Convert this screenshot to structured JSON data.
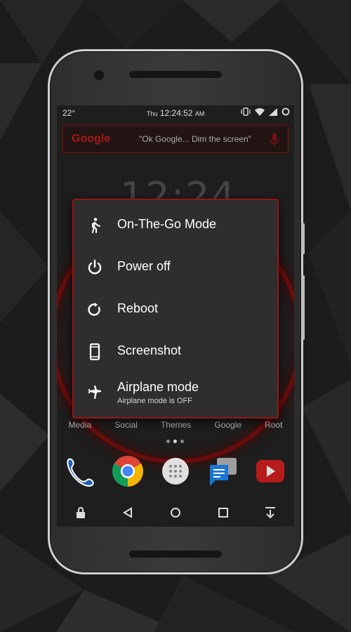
{
  "status_bar": {
    "temperature": "22°",
    "day": "Thu",
    "time": "12:24:52",
    "ampm": "AM"
  },
  "search": {
    "logo": "Google",
    "hint": "\"Ok Google... Dim the screen\""
  },
  "home": {
    "big_clock": "12:24",
    "dock_labels": [
      "Media",
      "Social",
      "Themes",
      "Google",
      "Root"
    ]
  },
  "power_menu": {
    "items": [
      {
        "label": "On-The-Go Mode",
        "icon": "walking-person-icon"
      },
      {
        "label": "Power off",
        "icon": "power-icon"
      },
      {
        "label": "Reboot",
        "icon": "refresh-icon"
      },
      {
        "label": "Screenshot",
        "icon": "phone-icon"
      },
      {
        "label": "Airplane mode",
        "subtitle": "Airplane mode is OFF",
        "icon": "airplane-icon"
      }
    ]
  },
  "colors": {
    "accent": "#9a1414",
    "dialog_bg": "#2e2e2e"
  }
}
